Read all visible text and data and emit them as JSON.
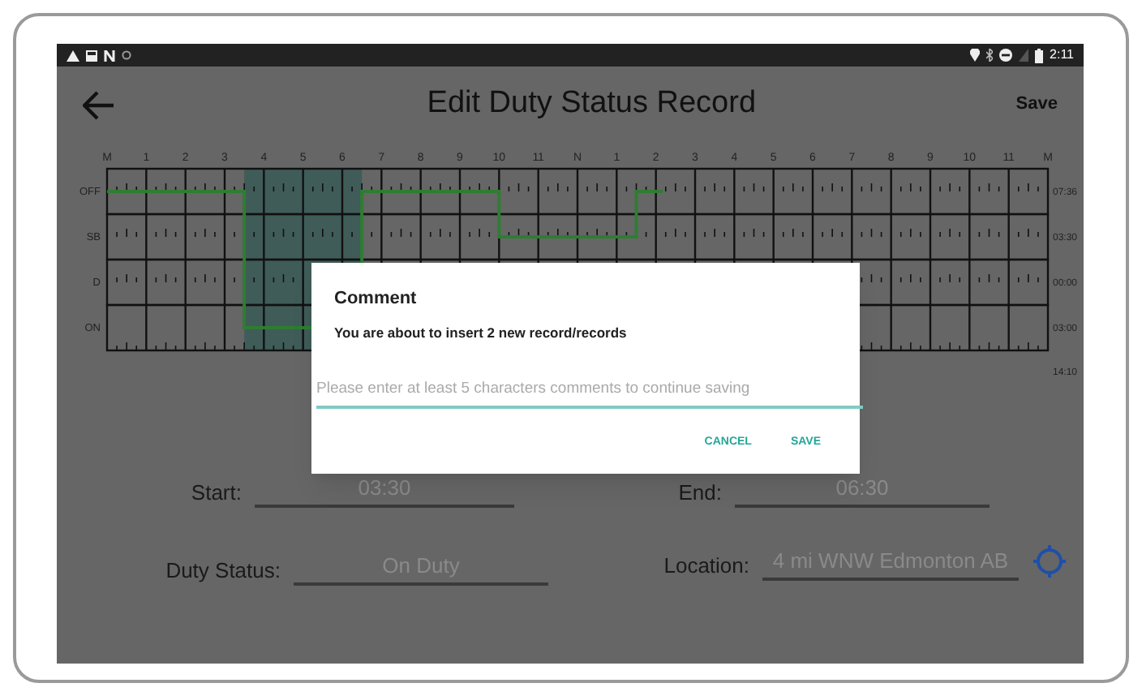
{
  "status_bar": {
    "time": "2:11"
  },
  "header": {
    "title": "Edit Duty Status Record",
    "save": "Save"
  },
  "log_chart": {
    "hour_labels": [
      "M",
      "1",
      "2",
      "3",
      "4",
      "5",
      "6",
      "7",
      "8",
      "9",
      "10",
      "11",
      "N",
      "1",
      "2",
      "3",
      "4",
      "5",
      "6",
      "7",
      "8",
      "9",
      "10",
      "11",
      "M"
    ],
    "row_labels": [
      "OFF",
      "SB",
      "D",
      "ON"
    ],
    "row_totals": [
      "07:36",
      "03:30",
      "00:00",
      "03:00"
    ],
    "total": "14:10"
  },
  "form": {
    "start": {
      "label": "Start:",
      "value": "03:30"
    },
    "end": {
      "label": "End:",
      "value": "06:30"
    },
    "duty_status": {
      "label": "Duty Status:",
      "value": "On Duty"
    },
    "location": {
      "label": "Location:",
      "value": "4 mi WNW Edmonton AB"
    }
  },
  "dialog": {
    "title": "Comment",
    "message": "You are about to insert 2 new record/records",
    "placeholder": "Please enter at least 5 characters comments to continue saving",
    "buttons": [
      "CANCEL",
      "SAVE"
    ]
  }
}
